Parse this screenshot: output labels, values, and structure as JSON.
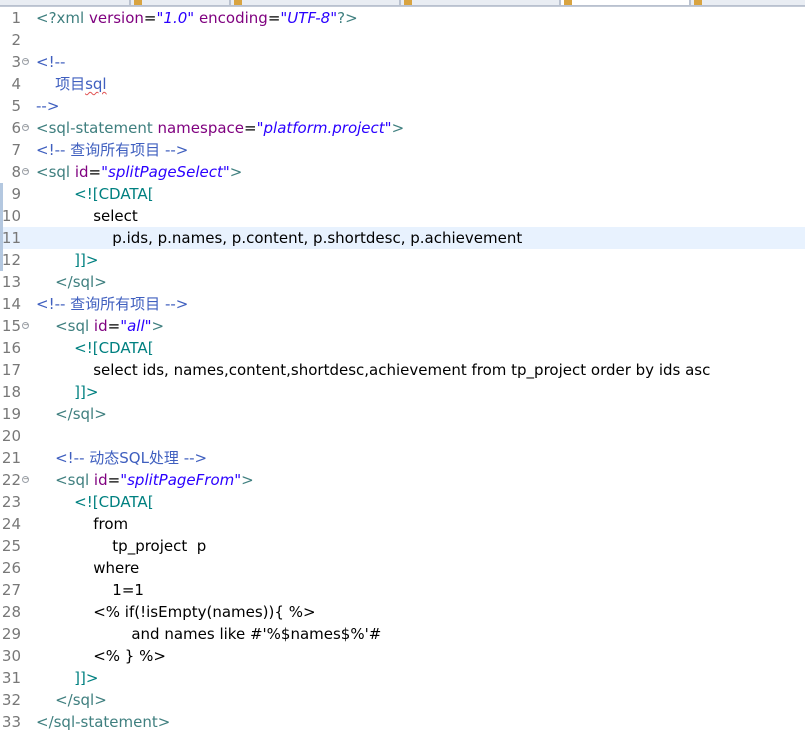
{
  "tabs": [
    {
      "label": ""
    },
    {
      "label": ""
    },
    {
      "label": ""
    },
    {
      "label": ""
    },
    {
      "label": ""
    },
    {
      "label": ""
    }
  ],
  "editor": {
    "current_line": 11,
    "lines": [
      {
        "n": "1",
        "fold": false,
        "tokens": [
          [
            "tag",
            "<?xml "
          ],
          [
            "attr",
            "version"
          ],
          [
            "text",
            "="
          ],
          [
            "val",
            "\"1.0\""
          ],
          [
            "text",
            " "
          ],
          [
            "attr",
            "encoding"
          ],
          [
            "text",
            "="
          ],
          [
            "val",
            "\"UTF-8\""
          ],
          [
            "tag",
            "?>"
          ]
        ]
      },
      {
        "n": "2",
        "fold": false,
        "tokens": []
      },
      {
        "n": "3",
        "fold": true,
        "tokens": [
          [
            "comment",
            "<!--"
          ]
        ]
      },
      {
        "n": "4",
        "fold": false,
        "tokens": [
          [
            "comment",
            "    项目"
          ],
          [
            "comment-sq",
            "sql"
          ]
        ]
      },
      {
        "n": "5",
        "fold": false,
        "tokens": [
          [
            "comment",
            "-->"
          ]
        ]
      },
      {
        "n": "6",
        "fold": true,
        "tokens": [
          [
            "tag",
            "<sql-statement "
          ],
          [
            "attr",
            "namespace"
          ],
          [
            "text",
            "="
          ],
          [
            "val",
            "\"platform.project\""
          ],
          [
            "tag",
            ">"
          ]
        ]
      },
      {
        "n": "7",
        "fold": false,
        "tokens": [
          [
            "comment",
            "<!-- 查询所有项目 -->"
          ]
        ]
      },
      {
        "n": "8",
        "fold": true,
        "tokens": [
          [
            "tag",
            "<sql "
          ],
          [
            "attr",
            "id"
          ],
          [
            "text",
            "="
          ],
          [
            "val",
            "\"splitPageSelect\""
          ],
          [
            "tag",
            ">"
          ]
        ]
      },
      {
        "n": "9",
        "fold": false,
        "mark": true,
        "tokens": [
          [
            "cdata",
            "        <![CDATA["
          ]
        ]
      },
      {
        "n": "10",
        "fold": false,
        "mark": true,
        "tokens": [
          [
            "text",
            "            select"
          ]
        ]
      },
      {
        "n": "11",
        "fold": false,
        "mark": true,
        "tokens": [
          [
            "text",
            "                p.ids, p.names, p.content, p.shortdesc, p.achievement"
          ]
        ]
      },
      {
        "n": "12",
        "fold": false,
        "mark": true,
        "tokens": [
          [
            "cdata",
            "        ]]>"
          ]
        ]
      },
      {
        "n": "13",
        "fold": false,
        "tokens": [
          [
            "tag",
            "    </sql>"
          ]
        ]
      },
      {
        "n": "14",
        "fold": false,
        "tokens": [
          [
            "comment",
            "<!-- 查询所有项目 -->"
          ]
        ]
      },
      {
        "n": "15",
        "fold": true,
        "tokens": [
          [
            "tag",
            "    <sql "
          ],
          [
            "attr",
            "id"
          ],
          [
            "text",
            "="
          ],
          [
            "val",
            "\"all\""
          ],
          [
            "tag",
            ">"
          ]
        ]
      },
      {
        "n": "16",
        "fold": false,
        "tokens": [
          [
            "cdata",
            "        <![CDATA["
          ]
        ]
      },
      {
        "n": "17",
        "fold": false,
        "tokens": [
          [
            "text",
            "            select ids, names,content,shortdesc,achievement from tp_project order by ids asc"
          ]
        ]
      },
      {
        "n": "18",
        "fold": false,
        "tokens": [
          [
            "cdata",
            "        ]]>"
          ]
        ]
      },
      {
        "n": "19",
        "fold": false,
        "tokens": [
          [
            "tag",
            "    </sql>"
          ]
        ]
      },
      {
        "n": "20",
        "fold": false,
        "tokens": []
      },
      {
        "n": "21",
        "fold": false,
        "tokens": [
          [
            "comment",
            "    <!-- 动态SQL处理 -->"
          ]
        ]
      },
      {
        "n": "22",
        "fold": true,
        "tokens": [
          [
            "tag",
            "    <sql "
          ],
          [
            "attr",
            "id"
          ],
          [
            "text",
            "="
          ],
          [
            "val",
            "\"splitPageFrom\""
          ],
          [
            "tag",
            ">"
          ]
        ]
      },
      {
        "n": "23",
        "fold": false,
        "tokens": [
          [
            "cdata",
            "        <![CDATA["
          ]
        ]
      },
      {
        "n": "24",
        "fold": false,
        "tokens": [
          [
            "text",
            "            from"
          ]
        ]
      },
      {
        "n": "25",
        "fold": false,
        "tokens": [
          [
            "text",
            "                tp_project  p"
          ]
        ]
      },
      {
        "n": "26",
        "fold": false,
        "tokens": [
          [
            "text",
            "            where"
          ]
        ]
      },
      {
        "n": "27",
        "fold": false,
        "tokens": [
          [
            "text",
            "                1=1"
          ]
        ]
      },
      {
        "n": "28",
        "fold": false,
        "tokens": [
          [
            "text",
            "            <% if(!isEmpty(names)){ %>"
          ]
        ]
      },
      {
        "n": "29",
        "fold": false,
        "tokens": [
          [
            "text",
            "                    and names like #'%$names$%'#"
          ]
        ]
      },
      {
        "n": "30",
        "fold": false,
        "tokens": [
          [
            "text",
            "            <% } %>"
          ]
        ]
      },
      {
        "n": "31",
        "fold": false,
        "tokens": [
          [
            "cdata",
            "        ]]>"
          ]
        ]
      },
      {
        "n": "32",
        "fold": false,
        "tokens": [
          [
            "tag",
            "    </sql>"
          ]
        ]
      },
      {
        "n": "33",
        "fold": false,
        "tokens": [
          [
            "tag",
            "</sql-statement>"
          ]
        ]
      }
    ]
  }
}
